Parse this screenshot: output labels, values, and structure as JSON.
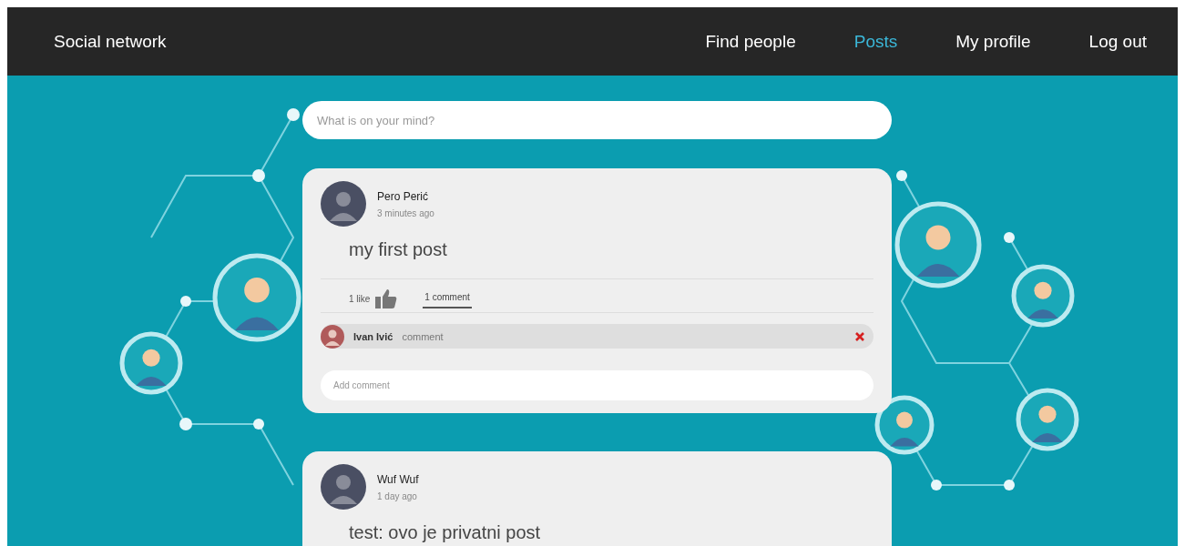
{
  "navbar": {
    "brand": "Social network",
    "links": [
      {
        "label": "Find people",
        "selected": false
      },
      {
        "label": "Posts",
        "selected": true
      },
      {
        "label": "My profile",
        "selected": false
      },
      {
        "label": "Log out",
        "selected": false
      }
    ]
  },
  "composer": {
    "placeholder": "What is on your mind?"
  },
  "posts": [
    {
      "author": "Pero Perić",
      "time": "3 minutes ago",
      "content": "my first post",
      "likes": "1 like",
      "comments_label": "1 comment",
      "comments_expanded": true,
      "comments": [
        {
          "author": "Ivan Ivić",
          "text": "comment"
        }
      ],
      "add_comment": {
        "placeholder": "Add comment"
      }
    },
    {
      "author": "Wuf Wuf",
      "time": "1 day ago",
      "content": "test: ovo je privatni post"
    }
  ]
}
